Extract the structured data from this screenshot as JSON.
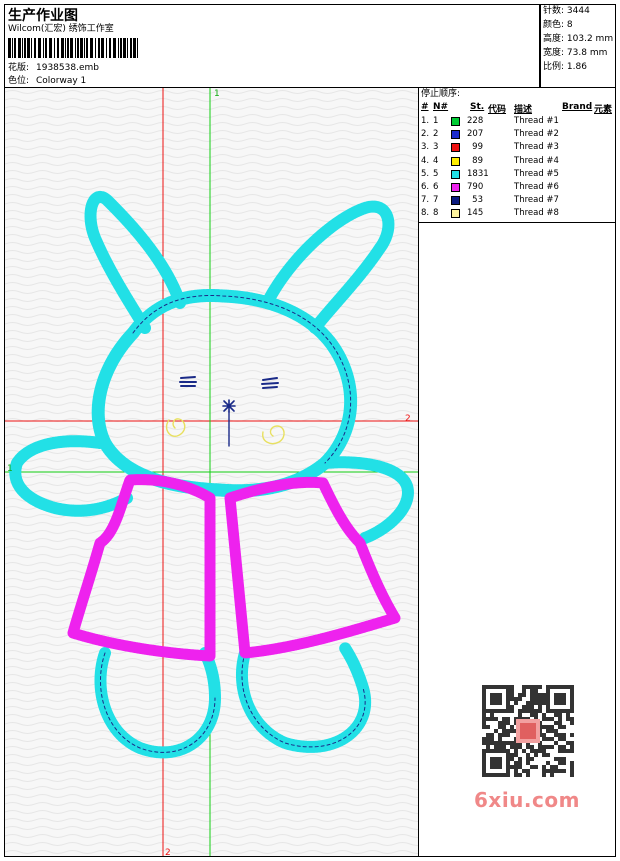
{
  "header": {
    "title": "生产作业图",
    "company": "Wilcom(汇宏) 绣饰工作室",
    "barcode_label": "barcode",
    "design_label": "花版:",
    "design_value": "1938538.emb",
    "colorway_label": "色位:",
    "colorway_value": "Colorway 1"
  },
  "stats": {
    "stitches_label": "针数:",
    "stitches_value": "3444",
    "colors_label": "颜色:",
    "colors_value": "8",
    "height_label": "高度:",
    "height_value": "103.2 mm",
    "width_label": "宽度:",
    "width_value": "73.8 mm",
    "scale_label": "比例:",
    "scale_value": "1.86"
  },
  "sequence": {
    "title": "停止顺序:",
    "columns": {
      "num": "#",
      "n": "N#",
      "st": "St.",
      "code": "代码",
      "desc": "描述",
      "brand": "Brand",
      "elem": "元素"
    },
    "rows": [
      {
        "num": "1.",
        "n": "1",
        "color": "#00cc33",
        "st": "228",
        "desc": "Thread #1"
      },
      {
        "num": "2.",
        "n": "2",
        "color": "#1a2acc",
        "st": "207",
        "desc": "Thread #2"
      },
      {
        "num": "3.",
        "n": "3",
        "color": "#ee1111",
        "st": "99",
        "desc": "Thread #3"
      },
      {
        "num": "4.",
        "n": "4",
        "color": "#ffee00",
        "st": "89",
        "desc": "Thread #4"
      },
      {
        "num": "5.",
        "n": "5",
        "color": "#22e0e6",
        "st": "1831",
        "desc": "Thread #5"
      },
      {
        "num": "6.",
        "n": "6",
        "color": "#ee22ee",
        "st": "790",
        "desc": "Thread #6"
      },
      {
        "num": "7.",
        "n": "7",
        "color": "#0a1a80",
        "st": "53",
        "desc": "Thread #7"
      },
      {
        "num": "8.",
        "n": "8",
        "color": "#fff5a0",
        "st": "145",
        "desc": "Thread #8"
      }
    ]
  },
  "canvas": {
    "marker_top": "1",
    "marker_right": "2",
    "marker_bottom": "2",
    "marker_left": "1",
    "watermark": "6xiu.com",
    "qr_label": "qr"
  },
  "colors": {
    "cyan": "#22e0e6",
    "magenta": "#ee22ee",
    "navy": "#1a2a88",
    "yellow": "#e8e060",
    "guide_red": "#ee1111",
    "guide_green": "#11cc11"
  }
}
